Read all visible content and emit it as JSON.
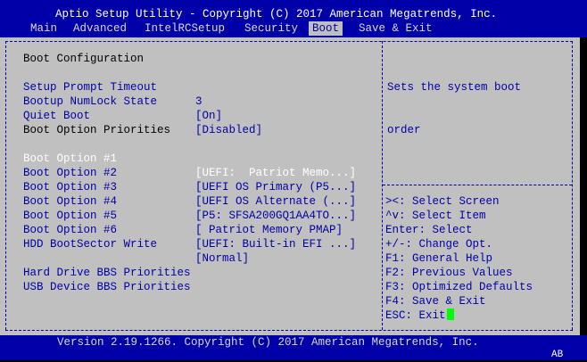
{
  "header": {
    "title": "Aptio Setup Utility - Copyright (C) 2017 American Megatrends, Inc.",
    "tabs": [
      "Main",
      "Advanced",
      "IntelRCSetup",
      "Security",
      "Boot",
      "Save & Exit"
    ],
    "active_tab": "Boot"
  },
  "settings": {
    "boot_configuration_heading": "Boot Configuration",
    "setup_prompt_timeout": {
      "label": "Setup Prompt Timeout",
      "value": "3"
    },
    "bootup_numlock_state": {
      "label": "Bootup NumLock State",
      "value": "[On]"
    },
    "quiet_boot": {
      "label": "Quiet Boot",
      "value": "[Disabled]"
    },
    "boot_option_priorities_heading": "Boot Option Priorities",
    "boot_options": [
      {
        "label": "Boot Option #1",
        "value": "[UEFI:  Patriot Memo...]"
      },
      {
        "label": "Boot Option #2",
        "value": "[UEFI OS Primary (P5...]"
      },
      {
        "label": "Boot Option #3",
        "value": "[UEFI OS Alternate (...]"
      },
      {
        "label": "Boot Option #4",
        "value": "[P5: SFSA200GQ1AA4TO...]"
      },
      {
        "label": "Boot Option #5",
        "value": "[ Patriot Memory PMAP]"
      },
      {
        "label": "Boot Option #6",
        "value": "[UEFI: Built-in EFI ...]"
      }
    ],
    "hdd_bootsector_write": {
      "label": "HDD BootSector Write",
      "value": "[Normal]"
    },
    "hard_drive_bbs": "Hard Drive BBS Priorities",
    "usb_device_bbs": "USB Device BBS Priorities"
  },
  "help": {
    "line1": "Sets the system boot",
    "line2": "order",
    "keys": [
      "><: Select Screen",
      "^v: Select Item",
      "Enter: Select",
      "+/-: Change Opt.",
      "F1: General Help",
      "F2: Previous Values",
      "F3: Optimized Defaults",
      "F4: Save & Exit",
      "ESC: Exit"
    ]
  },
  "footer": {
    "version": "Version 2.19.1266. Copyright (C) 2017 American Megatrends, Inc.",
    "corner": "AB"
  },
  "colors": {
    "bar_blue": "#0000a8",
    "panel_gray": "#c0c0c0",
    "cursor_green": "#00ff00",
    "selected_text": "#ffffff"
  }
}
